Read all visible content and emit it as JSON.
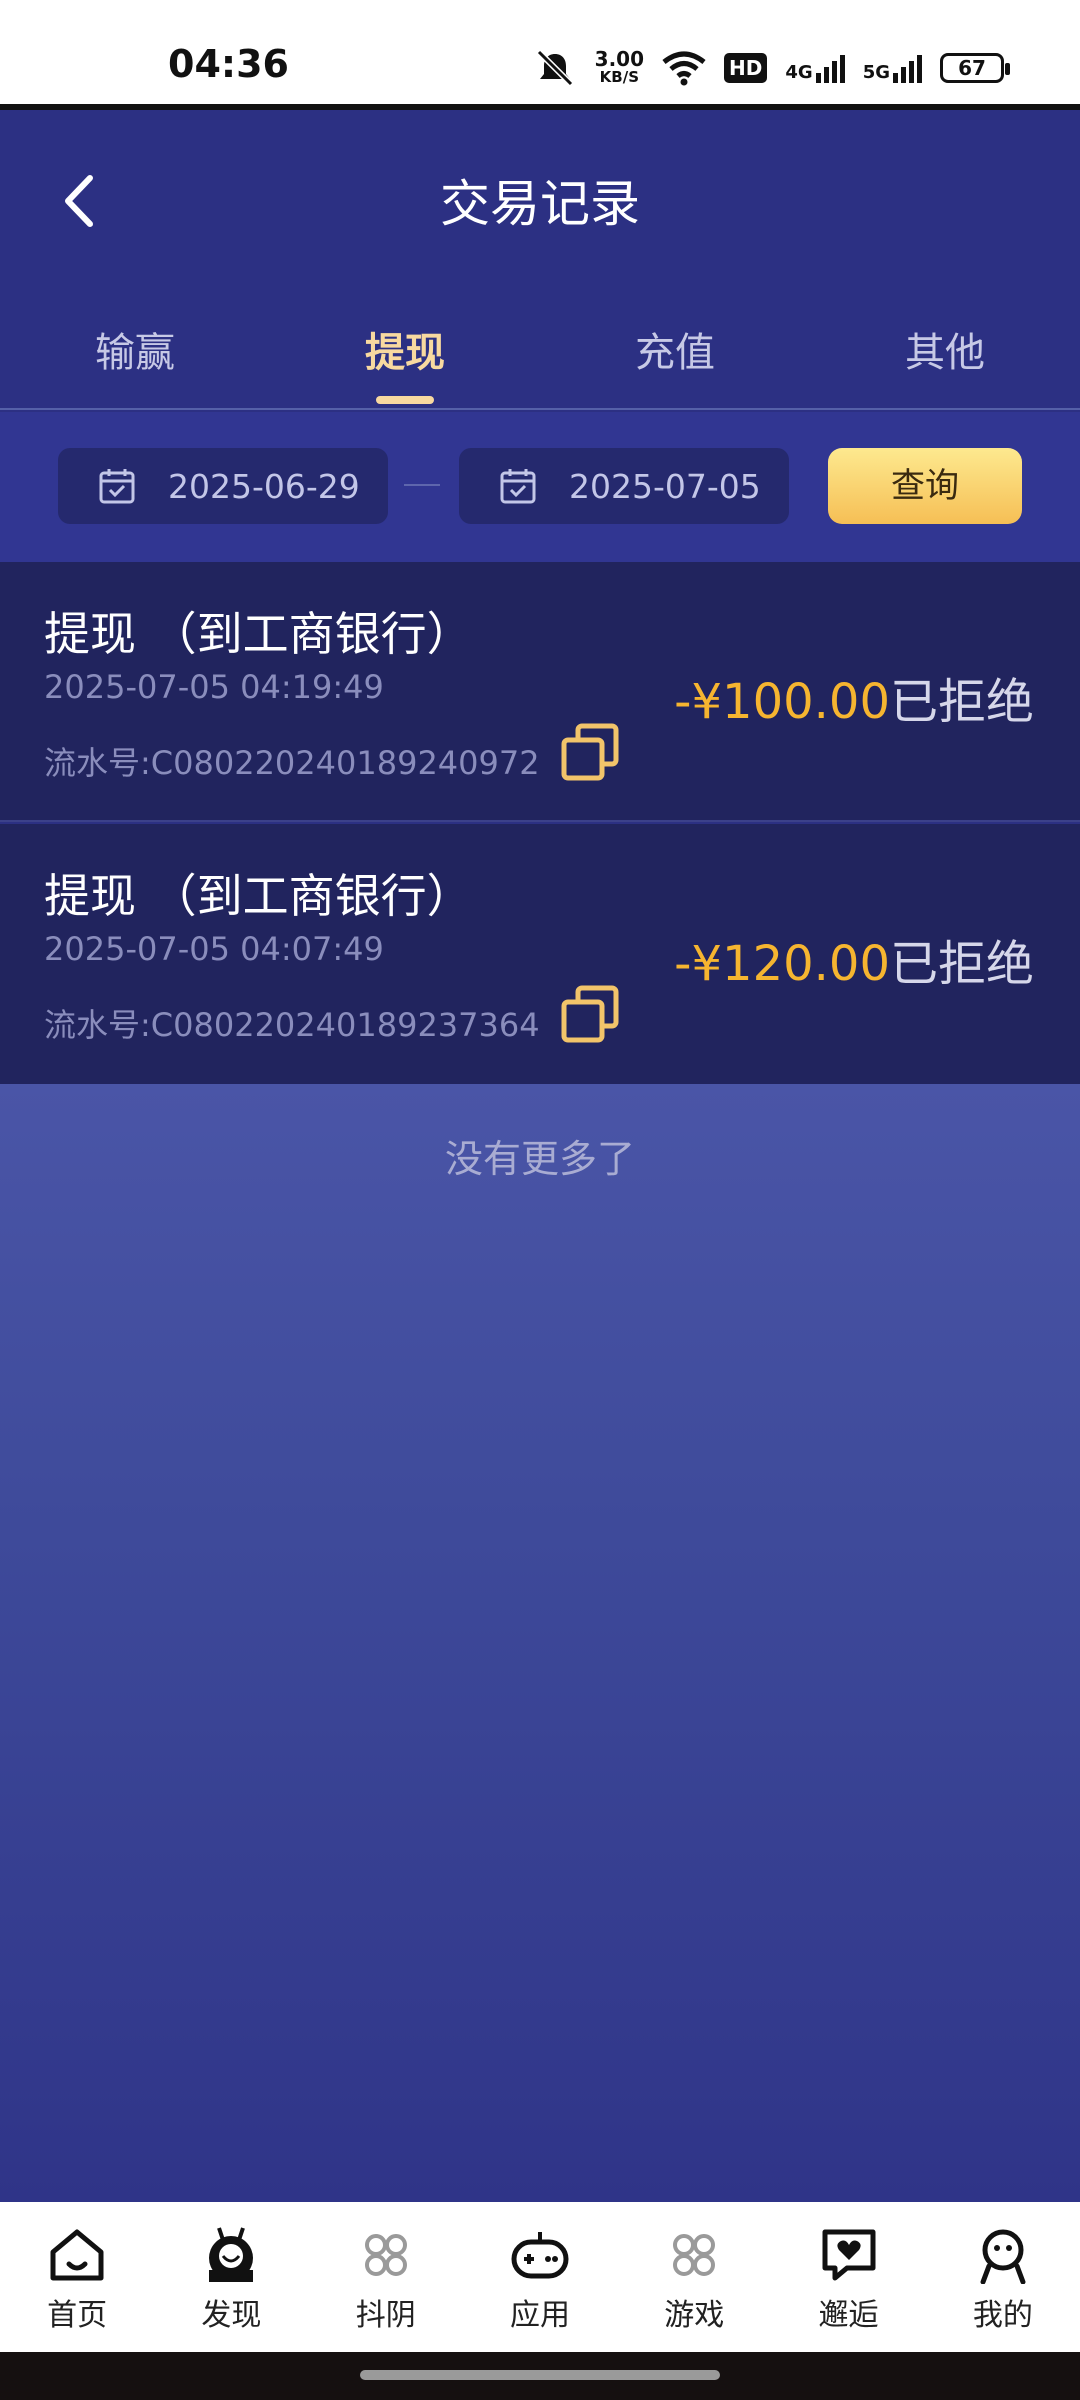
{
  "status_bar": {
    "time": "04:36",
    "speed_value": "3.00",
    "speed_unit": "KB/S",
    "hd_label": "HD",
    "net1": "4G",
    "net2": "5G",
    "battery": "67"
  },
  "header": {
    "title": "交易记录",
    "back_icon": "chevron-left-icon"
  },
  "tabs": [
    {
      "label": "输赢",
      "active": false
    },
    {
      "label": "提现",
      "active": true
    },
    {
      "label": "充值",
      "active": false
    },
    {
      "label": "其他",
      "active": false
    }
  ],
  "filter": {
    "start_date": "2025-06-29",
    "end_date": "2025-07-05",
    "query_label": "查询"
  },
  "records": [
    {
      "title": "提现 （到工商银行）",
      "time": "2025-07-05 04:19:49",
      "serial": "流水号:C080220240189240972",
      "amount": "-¥100.00",
      "status": "已拒绝"
    },
    {
      "title": "提现 （到工商银行）",
      "time": "2025-07-05 04:07:49",
      "serial": "流水号:C080220240189237364",
      "amount": "-¥120.00",
      "status": "已拒绝"
    }
  ],
  "no_more": "没有更多了",
  "bottom_nav": [
    {
      "label": "首页",
      "icon": "home-icon"
    },
    {
      "label": "发现",
      "icon": "discover-icon"
    },
    {
      "label": "抖阴",
      "icon": "grid-icon"
    },
    {
      "label": "应用",
      "icon": "gamepad-icon"
    },
    {
      "label": "游戏",
      "icon": "grid-icon"
    },
    {
      "label": "邂逅",
      "icon": "heart-chat-icon"
    },
    {
      "label": "我的",
      "icon": "profile-icon"
    }
  ],
  "colors": {
    "background": "#2c3083",
    "accent_gold": "#f6b530",
    "tab_active": "#f8d9a0"
  }
}
